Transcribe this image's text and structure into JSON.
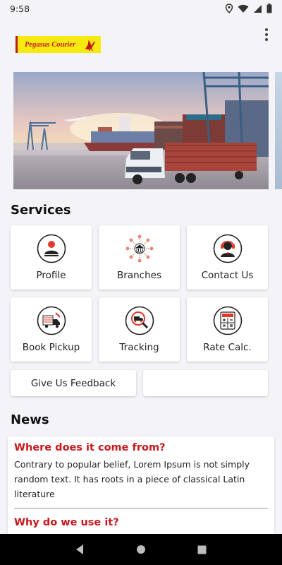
{
  "status": {
    "time": "9:58"
  },
  "app": {
    "logo_text": "Pegasus Courier"
  },
  "services": {
    "title": "Services",
    "items": [
      {
        "label": "Profile",
        "icon": "profile-icon"
      },
      {
        "label": "Branches",
        "icon": "branches-icon"
      },
      {
        "label": "Contact Us",
        "icon": "contact-support-icon"
      },
      {
        "label": "Book Pickup",
        "icon": "pickup-truck-icon"
      },
      {
        "label": "Tracking",
        "icon": "tracking-icon"
      },
      {
        "label": "Rate Calc.",
        "icon": "calculator-icon"
      }
    ],
    "feedback_label": "Give Us Feedback",
    "blank_button_label": ""
  },
  "news": {
    "title": "News",
    "items": [
      {
        "title": "Where does it come from?",
        "body": "Contrary to popular belief, Lorem Ipsum is not simply random text. It has roots in a piece of classical Latin literature"
      },
      {
        "title": "Why do we use it?"
      }
    ]
  },
  "colors": {
    "accent": "#c8171d",
    "logo_bg": "#f7ea10",
    "background": "#f4f4f8"
  }
}
